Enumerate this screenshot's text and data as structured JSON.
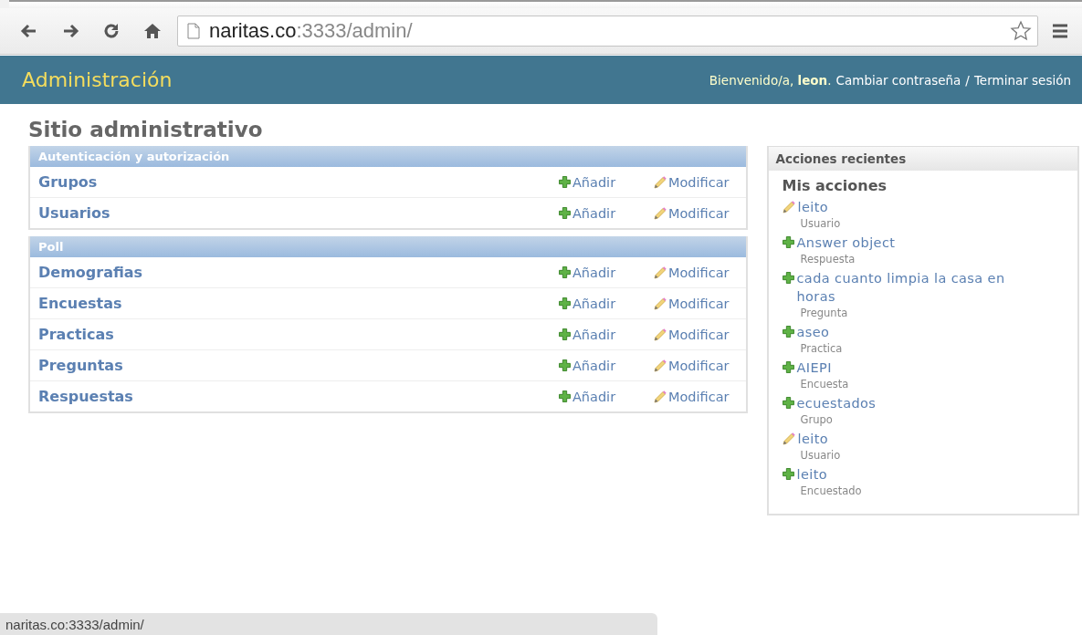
{
  "browser": {
    "address_host": "naritas.co",
    "address_path": ":3333/admin/",
    "bookmarked": false
  },
  "header": {
    "branding": "Administración",
    "welcome": "Bienvenido/a, ",
    "user": "leon",
    "user_end": ".",
    "links": [
      {
        "label": "Cambiar contraseña"
      },
      {
        "label": "Terminar sesión"
      }
    ],
    "separator": "/"
  },
  "page_title": "Sitio administrativo",
  "modules": [
    {
      "caption": "Autenticación y autorización",
      "models": [
        {
          "name": "Grupos",
          "add": "Añadir",
          "change": "Modificar"
        },
        {
          "name": "Usuarios",
          "add": "Añadir",
          "change": "Modificar"
        }
      ]
    },
    {
      "caption": "Poll",
      "models": [
        {
          "name": "Demografias",
          "add": "Añadir",
          "change": "Modificar"
        },
        {
          "name": "Encuestas",
          "add": "Añadir",
          "change": "Modificar"
        },
        {
          "name": "Practicas",
          "add": "Añadir",
          "change": "Modificar"
        },
        {
          "name": "Preguntas",
          "add": "Añadir",
          "change": "Modificar"
        },
        {
          "name": "Respuestas",
          "add": "Añadir",
          "change": "Modificar"
        }
      ]
    }
  ],
  "recent_actions": {
    "title": "Acciones recientes",
    "subtitle": "Mis acciones",
    "items": [
      {
        "kind": "change",
        "label": "leito",
        "type": "Usuario"
      },
      {
        "kind": "add",
        "label": "Answer object",
        "type": "Respuesta"
      },
      {
        "kind": "add",
        "label": "cada cuanto limpia la casa en horas",
        "type": "Pregunta"
      },
      {
        "kind": "add",
        "label": "aseo",
        "type": "Practica"
      },
      {
        "kind": "add",
        "label": "AIEPI",
        "type": "Encuesta"
      },
      {
        "kind": "add",
        "label": "ecuestados",
        "type": "Grupo"
      },
      {
        "kind": "change",
        "label": "leito",
        "type": "Usuario"
      },
      {
        "kind": "add",
        "label": "leito",
        "type": "Encuestado"
      }
    ]
  },
  "status_bar": {
    "text": "naritas.co:3333/admin/"
  }
}
